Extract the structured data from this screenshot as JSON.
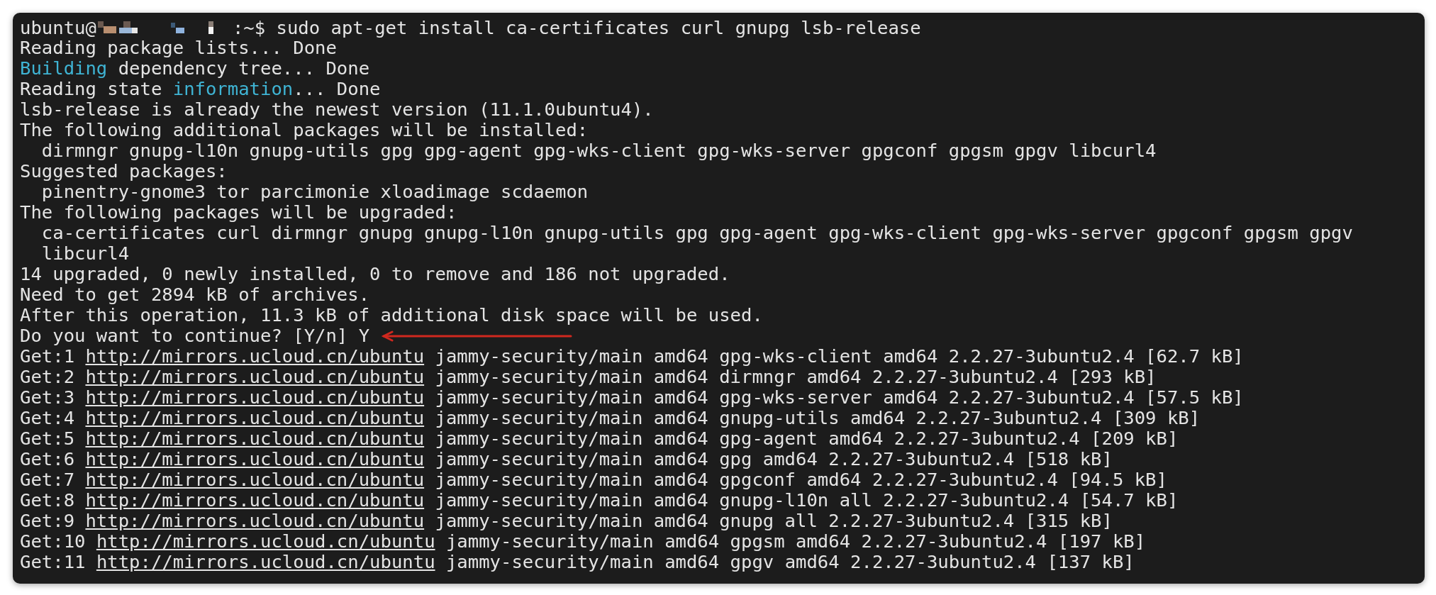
{
  "prompt": {
    "user": "ubuntu@",
    "redacted": true,
    "command": ":~$ sudo apt-get install ca-certificates curl gnupg lsb-release"
  },
  "lines": [
    {
      "segments": [
        {
          "kind": "text",
          "text": "Reading package lists... Done"
        }
      ]
    },
    {
      "segments": [
        {
          "kind": "highlight",
          "text": "Building"
        },
        {
          "kind": "text",
          "text": " dependency tree... Done"
        }
      ]
    },
    {
      "segments": [
        {
          "kind": "text",
          "text": "Reading state "
        },
        {
          "kind": "highlight",
          "text": "information"
        },
        {
          "kind": "text",
          "text": "... Done"
        }
      ]
    },
    {
      "segments": [
        {
          "kind": "text",
          "text": "lsb-release is already the newest version (11.1.0ubuntu4)."
        }
      ]
    },
    {
      "segments": [
        {
          "kind": "text",
          "text": "The following additional packages will be installed:"
        }
      ]
    },
    {
      "segments": [
        {
          "kind": "text",
          "text": "  dirmngr gnupg-l10n gnupg-utils gpg gpg-agent gpg-wks-client gpg-wks-server gpgconf gpgsm gpgv libcurl4"
        }
      ]
    },
    {
      "segments": [
        {
          "kind": "text",
          "text": "Suggested packages:"
        }
      ]
    },
    {
      "segments": [
        {
          "kind": "text",
          "text": "  pinentry-gnome3 tor parcimonie xloadimage scdaemon"
        }
      ]
    },
    {
      "segments": [
        {
          "kind": "text",
          "text": "The following packages will be upgraded:"
        }
      ]
    },
    {
      "segments": [
        {
          "kind": "text",
          "text": "  ca-certificates curl dirmngr gnupg gnupg-l10n gnupg-utils gpg gpg-agent gpg-wks-client gpg-wks-server gpgconf gpgsm gpgv"
        }
      ]
    },
    {
      "segments": [
        {
          "kind": "text",
          "text": "  libcurl4"
        }
      ]
    },
    {
      "segments": [
        {
          "kind": "text",
          "text": "14 upgraded, 0 newly installed, 0 to remove and 186 not upgraded."
        }
      ]
    },
    {
      "segments": [
        {
          "kind": "text",
          "text": "Need to get 2894 kB of archives."
        }
      ]
    },
    {
      "segments": [
        {
          "kind": "text",
          "text": "After this operation, 11.3 kB of additional disk space will be used."
        }
      ]
    },
    {
      "segments": [
        {
          "kind": "text",
          "text": "Do you want to continue? [Y/n] Y"
        }
      ],
      "arrow": true
    },
    {
      "segments": [
        {
          "kind": "text",
          "text": "Get:1 "
        },
        {
          "kind": "link",
          "text": "http://mirrors.ucloud.cn/ubuntu"
        },
        {
          "kind": "text",
          "text": " jammy-security/main amd64 gpg-wks-client amd64 2.2.27-3ubuntu2.4 [62.7 kB]"
        }
      ]
    },
    {
      "segments": [
        {
          "kind": "text",
          "text": "Get:2 "
        },
        {
          "kind": "link",
          "text": "http://mirrors.ucloud.cn/ubuntu"
        },
        {
          "kind": "text",
          "text": " jammy-security/main amd64 dirmngr amd64 2.2.27-3ubuntu2.4 [293 kB]"
        }
      ]
    },
    {
      "segments": [
        {
          "kind": "text",
          "text": "Get:3 "
        },
        {
          "kind": "link",
          "text": "http://mirrors.ucloud.cn/ubuntu"
        },
        {
          "kind": "text",
          "text": " jammy-security/main amd64 gpg-wks-server amd64 2.2.27-3ubuntu2.4 [57.5 kB]"
        }
      ]
    },
    {
      "segments": [
        {
          "kind": "text",
          "text": "Get:4 "
        },
        {
          "kind": "link",
          "text": "http://mirrors.ucloud.cn/ubuntu"
        },
        {
          "kind": "text",
          "text": " jammy-security/main amd64 gnupg-utils amd64 2.2.27-3ubuntu2.4 [309 kB]"
        }
      ]
    },
    {
      "segments": [
        {
          "kind": "text",
          "text": "Get:5 "
        },
        {
          "kind": "link",
          "text": "http://mirrors.ucloud.cn/ubuntu"
        },
        {
          "kind": "text",
          "text": " jammy-security/main amd64 gpg-agent amd64 2.2.27-3ubuntu2.4 [209 kB]"
        }
      ]
    },
    {
      "segments": [
        {
          "kind": "text",
          "text": "Get:6 "
        },
        {
          "kind": "link",
          "text": "http://mirrors.ucloud.cn/ubuntu"
        },
        {
          "kind": "text",
          "text": " jammy-security/main amd64 gpg amd64 2.2.27-3ubuntu2.4 [518 kB]"
        }
      ]
    },
    {
      "segments": [
        {
          "kind": "text",
          "text": "Get:7 "
        },
        {
          "kind": "link",
          "text": "http://mirrors.ucloud.cn/ubuntu"
        },
        {
          "kind": "text",
          "text": " jammy-security/main amd64 gpgconf amd64 2.2.27-3ubuntu2.4 [94.5 kB]"
        }
      ]
    },
    {
      "segments": [
        {
          "kind": "text",
          "text": "Get:8 "
        },
        {
          "kind": "link",
          "text": "http://mirrors.ucloud.cn/ubuntu"
        },
        {
          "kind": "text",
          "text": " jammy-security/main amd64 gnupg-l10n all 2.2.27-3ubuntu2.4 [54.7 kB]"
        }
      ]
    },
    {
      "segments": [
        {
          "kind": "text",
          "text": "Get:9 "
        },
        {
          "kind": "link",
          "text": "http://mirrors.ucloud.cn/ubuntu"
        },
        {
          "kind": "text",
          "text": " jammy-security/main amd64 gnupg all 2.2.27-3ubuntu2.4 [315 kB]"
        }
      ]
    },
    {
      "segments": [
        {
          "kind": "text",
          "text": "Get:10 "
        },
        {
          "kind": "link",
          "text": "http://mirrors.ucloud.cn/ubuntu"
        },
        {
          "kind": "text",
          "text": " jammy-security/main amd64 gpgsm amd64 2.2.27-3ubuntu2.4 [197 kB]"
        }
      ]
    },
    {
      "segments": [
        {
          "kind": "text",
          "text": "Get:11 "
        },
        {
          "kind": "link",
          "text": "http://mirrors.ucloud.cn/ubuntu"
        },
        {
          "kind": "text",
          "text": " jammy-security/main amd64 gpgv amd64 2.2.27-3ubuntu2.4 [137 kB]"
        }
      ]
    }
  ]
}
